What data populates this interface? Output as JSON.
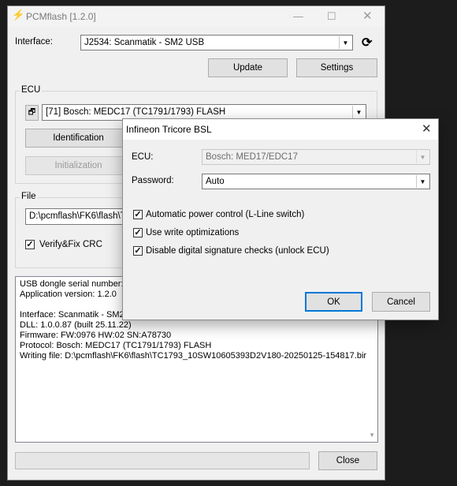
{
  "main_window": {
    "title": "PCMflash [1.2.0]",
    "interface_label": "Interface:",
    "interface_value": "J2534: Scanmatik - SM2 USB",
    "update_button": "Update",
    "settings_button": "Settings",
    "ecu_group_label": "ECU",
    "ecu_value": "[71] Bosch: MEDC17 (TC1791/1793) FLASH",
    "identification_button": "Identification",
    "initialization_button": "Initialization",
    "file_group_label": "File",
    "file_path": "D:\\pcmflash\\FK6\\flash\\TC",
    "verify_label": "Verify&Fix CRC",
    "verify_checked": true,
    "log_lines": [
      "USB dongle serial number: 3",
      "Application version: 1.2.0",
      "",
      "Interface: Scanmatik - SM2",
      "DLL: 1.0.0.87 (built 25.11.22)",
      "Firmware: FW:0976 HW:02 SN:A78730",
      "Protocol: Bosch: MEDC17 (TC1791/1793) FLASH",
      "Writing file: D:\\pcmflash\\FK6\\flash\\TC1793_10SW10605393D2V180-20250125-154817.bir"
    ],
    "close_button": "Close"
  },
  "dialog": {
    "title": "Infineon Tricore BSL",
    "ecu_label": "ECU:",
    "ecu_value": "Bosch: MED17/EDC17",
    "password_label": "Password:",
    "password_value": "Auto",
    "options": [
      {
        "label": "Automatic power control (L-Line switch)",
        "checked": true
      },
      {
        "label": "Use write optimizations",
        "checked": true
      },
      {
        "label": "Disable digital signature checks (unlock ECU)",
        "checked": true
      }
    ],
    "ok_button": "OK",
    "cancel_button": "Cancel"
  },
  "icons": {
    "app": "lightning-icon",
    "refresh": "refresh-icon",
    "ecu_window": "window-icon"
  }
}
